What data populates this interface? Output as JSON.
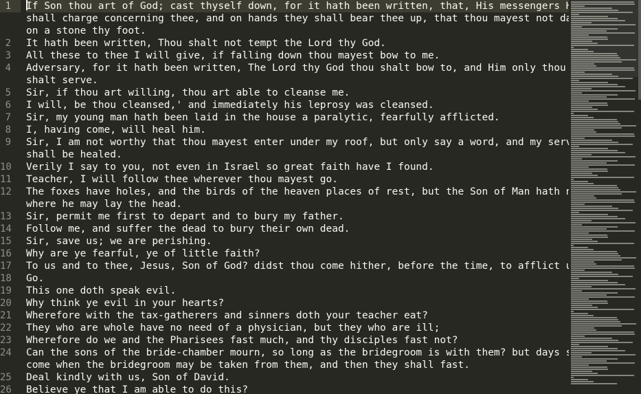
{
  "editor": {
    "theme_colors": {
      "background": "#272822",
      "text": "#f8f8f2",
      "gutter_text": "#90908a",
      "current_line": "#3e3d32"
    },
    "gutter": [
      "1",
      "",
      "",
      "2",
      "3",
      "4",
      "",
      "5",
      "6",
      "7",
      "8",
      "9",
      "",
      "10",
      "11",
      "12",
      "",
      "13",
      "14",
      "15",
      "16",
      "17",
      "18",
      "19",
      "20",
      "21",
      "22",
      "23",
      "24",
      "",
      "25",
      "26"
    ],
    "lines": [
      "If Son thou art of God; cast thyself down, for it hath been written, that, His messengers He",
      "shall charge concerning thee, and on hands they shall bear thee up, that thou mayest not dash",
      "on a stone thy foot.",
      "It hath been written, Thou shalt not tempt the Lord thy God.",
      "All these to thee I will give, if falling down thou mayest bow to me.",
      "Adversary, for it hath been written, The Lord thy God thou shalt bow to, and Him only thou",
      "shalt serve.",
      "Sir, if thou art willing, thou art able to cleanse me.",
      "I will, be thou cleansed,' and immediately his leprosy was cleansed.",
      "Sir, my young man hath been laid in the house a paralytic, fearfully afflicted.",
      "I, having come, will heal him.",
      "Sir, I am not worthy that thou mayest enter under my roof, but only say a word, and my servant",
      "shall be healed.",
      "Verily I say to you, not even in Israel so great faith have I found.",
      "Teacher, I will follow thee wherever thou mayest go.",
      "The foxes have holes, and the birds of the heaven places of rest, but the Son of Man hath not",
      "where he may lay the head.",
      "Sir, permit me first to depart and to bury my father.",
      "Follow me, and suffer the dead to bury their own dead.",
      "Sir, save us; we are perishing.",
      "Why are ye fearful, ye of little faith?",
      "To us and to thee, Jesus, Son of God? didst thou come hither, before the time, to afflict us",
      "Go.",
      "This one doth speak evil.",
      "Why think ye evil in your hearts?",
      "Wherefore with the tax-gatherers and sinners doth your teacher eat?",
      "They who are whole have no need of a physician, but they who are ill;",
      "Wherefore do we and the Pharisees fast much, and thy disciples fast not?",
      "Can the sons of the bride-chamber mourn, so long as the bridegroom is with them? but days shall",
      "come when the bridegroom may be taken from them, and then they shall fast.",
      "Deal kindly with us, Son of David.",
      "Believe ye that I am able to do this?"
    ]
  }
}
